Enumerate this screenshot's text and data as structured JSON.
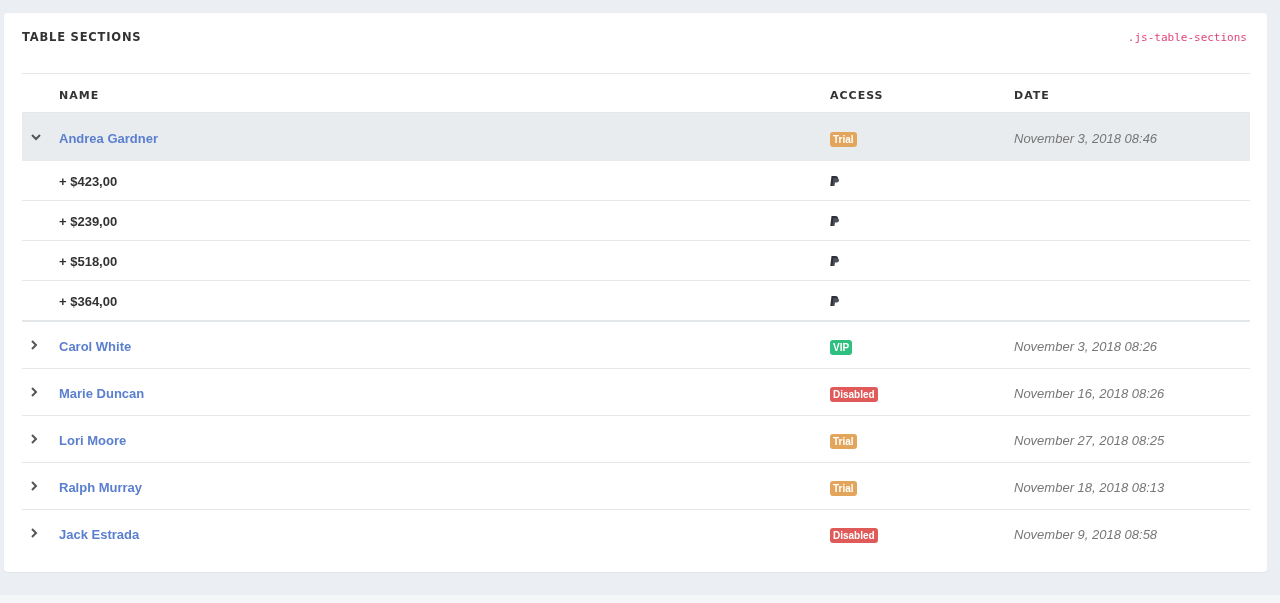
{
  "card": {
    "title": "TABLE SECTIONS",
    "code_label": ".js-table-sections"
  },
  "table": {
    "columns": [
      "NAME",
      "ACCESS",
      "DATE"
    ],
    "rows": [
      {
        "name": "Andrea Gardner",
        "access": {
          "label": "Trial",
          "color": "#e2a55b"
        },
        "date": "November 3, 2018 08:46",
        "expanded": true,
        "children": [
          {
            "amount": "+ $423,00"
          },
          {
            "amount": "+ $239,00"
          },
          {
            "amount": "+ $518,00"
          },
          {
            "amount": "+ $364,00"
          }
        ]
      },
      {
        "name": "Carol White",
        "access": {
          "label": "VIP",
          "color": "#2fbf7f"
        },
        "date": "November 3, 2018 08:26",
        "expanded": false
      },
      {
        "name": "Marie Duncan",
        "access": {
          "label": "Disabled",
          "color": "#e05a5a"
        },
        "date": "November 16, 2018 08:26",
        "expanded": false
      },
      {
        "name": "Lori Moore",
        "access": {
          "label": "Trial",
          "color": "#e2a55b"
        },
        "date": "November 27, 2018 08:25",
        "expanded": false
      },
      {
        "name": "Ralph Murray",
        "access": {
          "label": "Trial",
          "color": "#e2a55b"
        },
        "date": "November 18, 2018 08:13",
        "expanded": false
      },
      {
        "name": "Jack Estrada",
        "access": {
          "label": "Disabled",
          "color": "#e05a5a"
        },
        "date": "November 9, 2018 08:58",
        "expanded": false
      }
    ]
  }
}
